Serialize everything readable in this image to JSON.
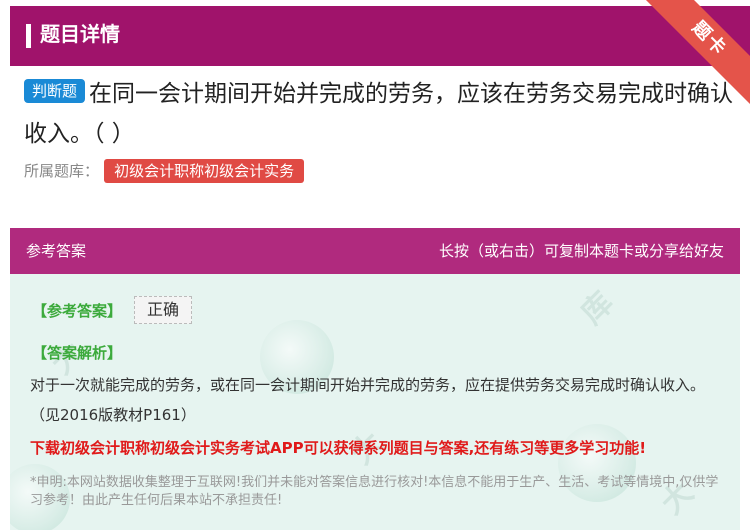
{
  "header": {
    "title": "题目详情",
    "corner_badge": "题卡"
  },
  "question": {
    "type_label": "判断题",
    "text": "在同一会计期间开始并完成的劳务，应该在劳务交易完成时确认收入。（ ）",
    "bank_label": "所属题库：",
    "bank_name": "初级会计职称初级会计实务"
  },
  "answer_section": {
    "title": "参考答案",
    "hint": "长按（或右击）可复制本题卡或分享给好友",
    "answer_label": "【参考答案】",
    "answer_value": "正确",
    "explanation_label": "【答案解析】",
    "explanation": "对于一次就能完成的劳务，或在同一会计期间开始并完成的劳务，应在提供劳务交易完成时确认收入。（见2016版教材P161）",
    "promo": "下载初级会计职称初级会计实务考试APP可以获得系列题目与答案,还有练习等更多学习功能!",
    "disclaimer": "*申明:本网站数据收集整理于互联网!我们并未能对答案信息进行核对!本信息不能用于生产、生活、考试等情境中,仅供学习参考！由此产生任何后果本站不承担责任!"
  },
  "colors": {
    "header": "#a0136b",
    "answer_header": "#b02a7e",
    "badge_blue": "#1a8ad6",
    "tag_red": "#e04a44",
    "promo_red": "#e01a1a",
    "green": "#3caa3c"
  }
}
